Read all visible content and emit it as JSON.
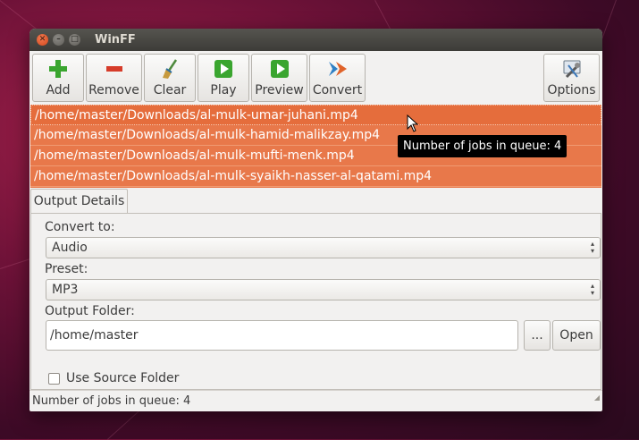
{
  "window": {
    "title": "WinFF"
  },
  "toolbar": {
    "add": "Add",
    "remove": "Remove",
    "clear": "Clear",
    "play": "Play",
    "preview": "Preview",
    "convert": "Convert",
    "options": "Options"
  },
  "files": [
    "/home/master/Downloads/al-mulk-umar-juhani.mp4",
    "/home/master/Downloads/al-mulk-hamid-malikzay.mp4",
    "/home/master/Downloads/al-mulk-mufti-menk.mp4",
    "/home/master/Downloads/al-mulk-syaikh-nasser-al-qatami.mp4"
  ],
  "tooltip": "Number of jobs in queue: 4",
  "tabs": {
    "output_details": "Output Details"
  },
  "output": {
    "convert_to_label": "Convert to:",
    "convert_to_value": "Audio",
    "preset_label": "Preset:",
    "preset_value": "MP3",
    "folder_label": "Output Folder:",
    "folder_value": "/home/master",
    "browse_label": "...",
    "open_label": "Open",
    "use_source_label": "Use Source Folder"
  },
  "status": "Number of jobs in queue: 4",
  "colors": {
    "selection": "#e8784a",
    "accent_green": "#3aa52f",
    "accent_red": "#d63c2a",
    "titlebar": "#3d3c38"
  },
  "icons": {
    "add": "plus-icon",
    "remove": "minus-icon",
    "clear": "broom-icon",
    "play": "play-icon",
    "preview": "preview-icon",
    "convert": "convert-arrows-icon",
    "options": "settings-tools-icon"
  }
}
